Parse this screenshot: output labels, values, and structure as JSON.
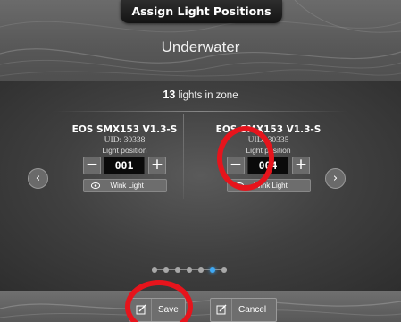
{
  "header": {
    "title": "Assign Light Positions"
  },
  "zone": {
    "name": "Underwater"
  },
  "summary": {
    "count": "13",
    "text": " lights in zone"
  },
  "cards": [
    {
      "device": "EOS SMX153 V1.3-S",
      "uid": "UID: 30338",
      "position_label": "Light position",
      "position_value": "001",
      "wink_label": "Wink Light"
    },
    {
      "device": "EOS SMX153 V1.3-S",
      "uid": "UID: 30335",
      "position_label": "Light position",
      "position_value": "004",
      "wink_label": "Wink Light"
    }
  ],
  "pager": {
    "page_count": 7,
    "current_page": 6
  },
  "footer": {
    "save_label": "Save",
    "cancel_label": "Cancel"
  },
  "colors": {
    "accent_dot": "#3fa9f5",
    "annotation_circle": "#e6141c"
  },
  "icons": [
    "minus-icon",
    "plus-icon",
    "eye-icon",
    "chevron-left-icon",
    "chevron-right-icon",
    "edit-icon"
  ]
}
